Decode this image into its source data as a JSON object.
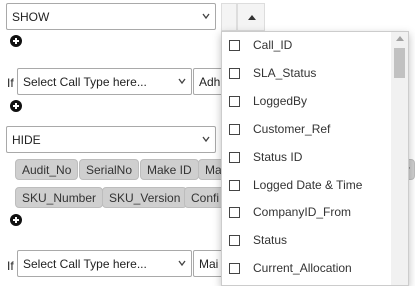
{
  "rows": {
    "show_select": "SHOW",
    "call_type_1": "Select Call Type here...",
    "partial_1": "Adh",
    "hide_select": "HIDE",
    "call_type_2": "Select Call Type here...",
    "partial_2": "Mai",
    "if_label": "If"
  },
  "chips_row1": [
    "Audit_No",
    "SerialNo",
    "Make ID",
    "Ma"
  ],
  "chips_row2": [
    "SKU_Number",
    "SKU_Version",
    "Confi"
  ],
  "chip_edge": "r",
  "dropdown": {
    "options": [
      "Call_ID",
      "SLA_Status",
      "LoggedBy",
      "Customer_Ref",
      "Status ID",
      "Logged Date & Time",
      "CompanyID_From",
      "Status",
      "Current_Allocation"
    ]
  }
}
